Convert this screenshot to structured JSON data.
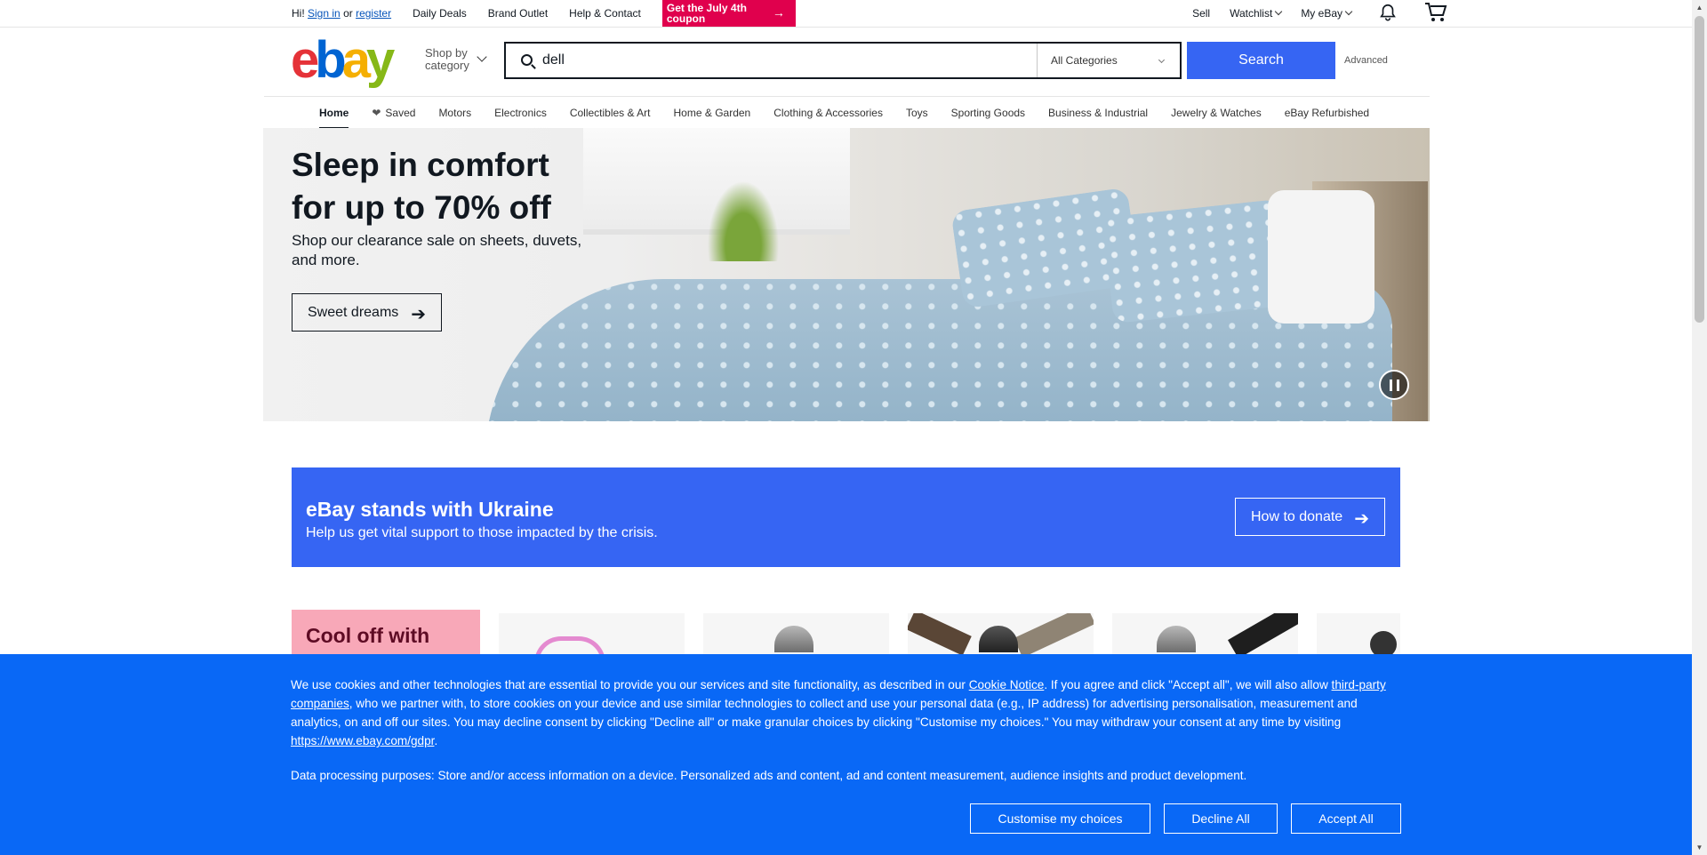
{
  "topbar": {
    "greeting_prefix": "Hi!",
    "sign_in": "Sign in",
    "or": "or",
    "register": "register",
    "links": [
      "Daily Deals",
      "Brand Outlet",
      "Help & Contact"
    ],
    "promo": "Get the July 4th coupon",
    "sell": "Sell",
    "watchlist": "Watchlist",
    "my_ebay": "My eBay",
    "notification_icon": "bell-icon",
    "cart_icon": "cart-icon"
  },
  "header": {
    "logo": "ebay",
    "shop_by_line1": "Shop by",
    "shop_by_line2": "category",
    "search_value": "dell",
    "category_select": "All Categories",
    "search_button": "Search",
    "advanced": "Advanced"
  },
  "nav": {
    "items": [
      "Home",
      "Saved",
      "Motors",
      "Electronics",
      "Collectibles & Art",
      "Home & Garden",
      "Clothing & Accessories",
      "Toys",
      "Sporting Goods",
      "Business & Industrial",
      "Jewelry & Watches",
      "eBay Refurbished"
    ]
  },
  "hero": {
    "title": "Sleep in comfort for up to 70% off",
    "subtitle": "Shop our clearance sale on sheets, duvets, and more.",
    "button": "Sweet dreams"
  },
  "ukraine": {
    "title": "eBay stands with Ukraine",
    "subtitle": "Help us get vital support to those impacted by the crisis.",
    "button": "How to donate"
  },
  "carousel": {
    "title": "Cool off with"
  },
  "cookie": {
    "t1": "We use cookies and other technologies that are essential to provide you our services and site functionality, as described in our ",
    "cookie_notice": "Cookie Notice",
    "t2": ". If you agree and click \"Accept all\", we will also allow ",
    "third_party": "third-party companies",
    "t3": ", who we partner with, to store cookies on your device and use similar technologies to collect and use your personal data (e.g., IP address) for advertising personalisation, measurement and analytics, on and off our sites. You may decline consent by clicking \"Decline all\" or make granular choices by clicking \"Customise my choices.\" You may withdraw your consent at any time by visiting ",
    "gdpr_link": "https://www.ebay.com/gdpr",
    "t4": ".",
    "purposes": "Data processing purposes: Store and/or access information on a device. Personalized ads and content, ad and content measurement, audience insights and product development.",
    "customise": "Customise my choices",
    "decline": "Decline All",
    "accept": "Accept All"
  },
  "colors": {
    "search_blue": "#3665f3",
    "cookie_blue": "#0968f6",
    "promo_red": "#e0004d",
    "cool_pink": "#f8a8b8"
  }
}
